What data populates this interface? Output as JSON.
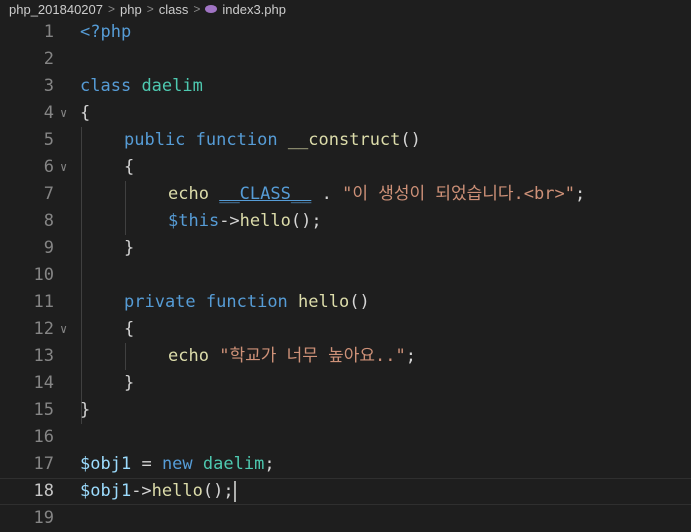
{
  "breadcrumb": {
    "folder1": "php_201840207",
    "folder2": "php",
    "folder3": "class",
    "file": "index3.php",
    "separator": ">"
  },
  "editor": {
    "current_line": 18,
    "lines": [
      {
        "n": "1",
        "t1": "<?php"
      },
      {
        "n": "2"
      },
      {
        "n": "3",
        "t1": "class",
        "t2": "daelim"
      },
      {
        "n": "4",
        "t1": "{"
      },
      {
        "n": "5",
        "t1": "public",
        "t2": "function",
        "t3": "__construct",
        "t4": "()"
      },
      {
        "n": "6",
        "t1": "{"
      },
      {
        "n": "7",
        "t1": "echo",
        "t2": "__CLASS__",
        "t3": ".",
        "t4": "\"이 생성이 되었습니다.<br>\"",
        "t5": ";"
      },
      {
        "n": "8",
        "t1": "$this",
        "t2": "->",
        "t3": "hello",
        "t4": "();"
      },
      {
        "n": "9",
        "t1": "}"
      },
      {
        "n": "10"
      },
      {
        "n": "11",
        "t1": "private",
        "t2": "function",
        "t3": "hello",
        "t4": "()"
      },
      {
        "n": "12",
        "t1": "{"
      },
      {
        "n": "13",
        "t1": "echo",
        "t2": "\"학교가 너무 높아요..\"",
        "t3": ";"
      },
      {
        "n": "14",
        "t1": "}"
      },
      {
        "n": "15",
        "t1": "}"
      },
      {
        "n": "16"
      },
      {
        "n": "17",
        "t1": "$obj1",
        "t2": "=",
        "t3": "new",
        "t4": "daelim",
        "t5": ";"
      },
      {
        "n": "18",
        "t1": "$obj1",
        "t2": "->",
        "t3": "hello",
        "t4": "();"
      },
      {
        "n": "19"
      }
    ]
  },
  "colors": {
    "background": "#1e1e1e",
    "keyword": "#569cd6",
    "function": "#dcdcaa",
    "class": "#4ec9b0",
    "variable": "#9cdcfe",
    "string": "#ce9178",
    "text": "#d4d4d4",
    "line_number": "#858585"
  },
  "icons": {
    "file_icon": "php-elephant-icon",
    "fold_icon": "chevron-down-icon"
  }
}
